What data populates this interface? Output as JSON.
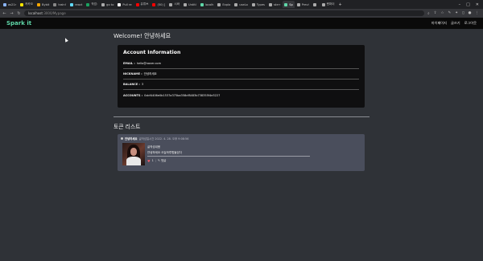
{
  "browser": {
    "tabs": [
      {
        "label": "as21r",
        "color": "#8ab4f8"
      },
      {
        "label": "카카오",
        "color": "#fee500"
      },
      {
        "label": "Bybit",
        "color": "#f7a600"
      },
      {
        "label": "train!",
        "color": "#888888"
      },
      {
        "label": "react",
        "color": "#61dafb"
      },
      {
        "label": "작업:",
        "color": "#1aa260"
      },
      {
        "label": "go to",
        "color": "#aaaaaa"
      },
      {
        "label": "Pull re",
        "color": "#ffffff"
      },
      {
        "label": "유튜브",
        "color": "#ff0000"
      },
      {
        "label": "(50) [",
        "color": "#ff0000"
      },
      {
        "label": "시바",
        "color": "#aaaaaa"
      },
      {
        "label": "Untitl",
        "color": "#aaaaaa"
      },
      {
        "label": "localh",
        "color": "#5fd7a8"
      },
      {
        "label": "Explo",
        "color": "#aaaaaa"
      },
      {
        "label": "useLo",
        "color": "#aaaaaa"
      },
      {
        "label": "Types",
        "color": "#aaaaaa"
      },
      {
        "label": "skrrr",
        "color": "#aaaaaa"
      },
      {
        "label": "Sp",
        "color": "#5fd7a8"
      },
      {
        "label": "Previ",
        "color": "#aaaaaa"
      },
      {
        "label": "",
        "color": "#aaaaaa"
      },
      {
        "label": "렌파이",
        "color": "#aaaaaa"
      }
    ],
    "active_tab_index": 17,
    "url_host": "localhost",
    "url_path": ":3000/Mypage"
  },
  "site": {
    "logo": "Spark it",
    "nav": [
      "마이페이지",
      "글쓰기",
      "로그아웃"
    ]
  },
  "welcome": "Welcome! 안녕하세요",
  "account": {
    "title": "Account Information",
    "rows": [
      {
        "key": "EMAIL :",
        "value": "hello@naver.com"
      },
      {
        "key": "NICKNAME :",
        "value": "안녕하세요"
      },
      {
        "key": "BALANCE :",
        "value": "3"
      },
      {
        "key": "ACCOUNTS :",
        "value": "0xbf4406e0b1537a375ba358cf8483b738355f4e3227"
      }
    ]
  },
  "tokens": {
    "title": "토큰 리스트",
    "items": [
      {
        "author": "안녕하세요",
        "meta": "글작성일시간 2022. 4. 28. 오후 9:08:56",
        "line1": "글작성내용",
        "line2": "안녕하세요 오늘하루힘들었다",
        "likes": "1",
        "comment_label": "댓글"
      }
    ]
  },
  "colors": {
    "logo": "#5fd7a8",
    "heart": "#ff5a6a",
    "token_card": "#4a4e5c",
    "account_card": "#0f0f10",
    "page_bg": "#2f3237"
  }
}
